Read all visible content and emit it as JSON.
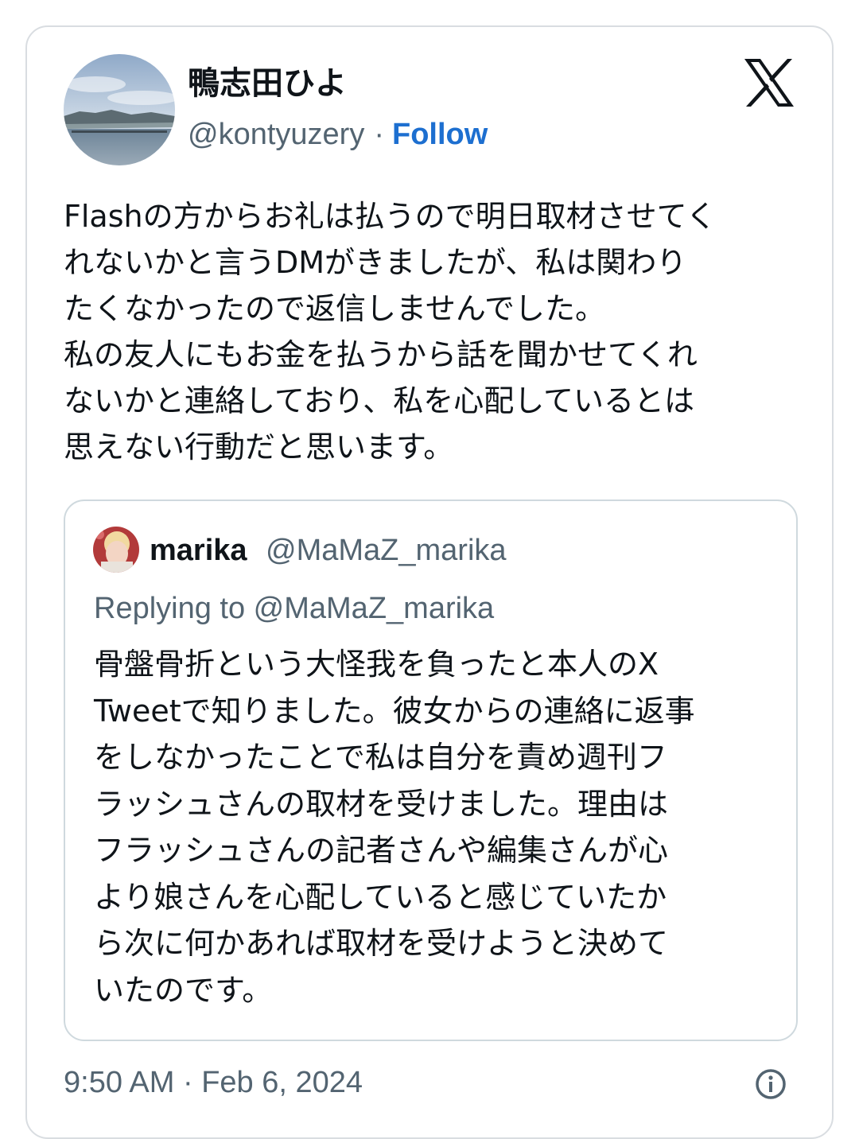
{
  "author": {
    "display_name": "鴨志田ひよ",
    "handle": "@kontyuzery",
    "separator": "·",
    "follow_label": "Follow"
  },
  "tweet": {
    "text": "Flashの方からお礼は払うので明日取材させてく\nれないかと言うDMがきましたが、私は関わり\nたくなかったので返信しませんでした。\n私の友人にもお金を払うから話を聞かせてくれ\nないかと連絡しており、私を心配しているとは\n思えない行動だと思います。",
    "timestamp": "9:50 AM · Feb 6, 2024"
  },
  "quoted_tweet": {
    "display_name": "marika",
    "handle": "@MaMaZ_marika",
    "replying_to": "Replying to @MaMaZ_marika",
    "text": "骨盤骨折という大怪我を負ったと本人のX\nTweetで知りました。彼女からの連絡に返事\nをしなかったことで私は自分を責め週刊フ\nラッシュさんの取材を受けました。理由は\nフラッシュさんの記者さんや編集さんが心\nより娘さんを心配していると感じていたか\nら次に何かあれば取材を受けようと決めて\nいたのです。"
  },
  "icons": {
    "logo": "x-logo-icon",
    "info": "info-icon"
  },
  "colors": {
    "follow": "#1d6fd0",
    "secondary_text": "#536471",
    "primary_text": "#0f1419",
    "border": "#cfd9de"
  }
}
